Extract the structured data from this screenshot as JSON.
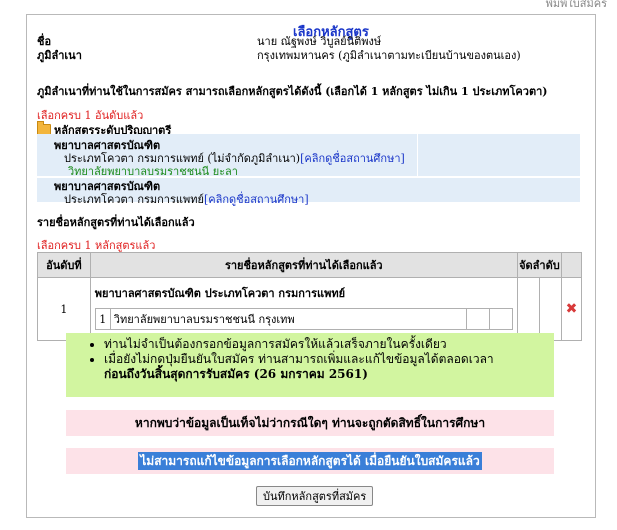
{
  "top_right_fragment": "พิมพ์ใบสมัคร",
  "legend": "เลือกหลักสูตร",
  "applicant": {
    "name_label": "ชื่อ",
    "name_value": "นาย ณัฐพงษ์ วิบูลย์นิติพงษ์",
    "domicile_label": "ภูมิลำเนา",
    "domicile_value": "กรุงเทพมหานคร (ภูมิลำเนาตามทะเบียนบ้านของตนเอง)"
  },
  "instruction": "ภูมิลำเนาที่ท่านใช้ในการสมัคร สามารถเลือกหลักสูตรได้ดังนี้ (เลือกได้ 1 หลักสูตร ไม่เกิน 1 ประเภทโควตา)",
  "rank_full": "เลือกครบ 1 อันดับแล้ว",
  "level_heading": "หลักสูตรระดับปริญญาตรี",
  "programs": [
    {
      "title": "พยาบาลศาสตรบัณฑิต",
      "quota": "ประเภทโควตา กรมการแพทย์ (ไม่จำกัดภูมิลำเนา)",
      "link": "[คลิกดูชื่อสถานศึกษา]",
      "college": "วิทยาลัยพยาบาลบรมราชชนนี ยะลา"
    },
    {
      "title": "พยาบาลศาสตรบัณฑิต",
      "quota": "ประเภทโควตา กรมการแพทย์",
      "link": "[คลิกดูชื่อสถานศึกษา]"
    }
  ],
  "selected_heading": "รายชื่อหลักสูตรที่ท่านได้เลือกแล้ว",
  "selected_full": "เลือกครบ 1 หลักสูตรแล้ว",
  "table": {
    "headers": [
      "อันดับที่",
      "รายชื่อหลักสูตรที่ท่านได้เลือกแล้ว",
      "จัดลำดับ"
    ],
    "row": {
      "rank": "1",
      "program": "พยาบาลศาสตรบัณฑิต ประเภทโควตา กรมการแพทย์",
      "sub_rank": "1",
      "sub_college": "วิทยาลัยพยาบาลบรมราชชนนี กรุงเทพ"
    }
  },
  "notices": [
    "ท่านไม่จำเป็นต้องกรอกข้อมูลการสมัครให้แล้วเสร็จภายในครั้งเดียว",
    "เมื่อยังไม่กดปุ่มยืนยันใบสมัคร ท่านสามารถเพิ่มและแก้ไขข้อมูลได้ตลอดเวลา",
    "ก่อนถึงวันสิ้นสุดการรับสมัคร (26 มกราคม 2561)"
  ],
  "warning": "หากพบว่าข้อมูลเป็นเท็จไม่ว่ากรณีใดๆ ท่านจะถูกตัดสิทธิ์ในการศึกษา",
  "locked_note": "ไม่สามารถแก้ไขข้อมูลการเลือกหลักสูตรได้ เมื่อยืนยันใบสมัครแล้ว",
  "save_button": "บันทึกหลักสูตรที่สมัคร",
  "colors": {
    "blue": "#1a36c9",
    "red": "#e02020",
    "green": "#1a8a1a",
    "notice_bg": "#d2f5a0",
    "warn_bg": "#fde2e8",
    "row_bg": "#e2edf8"
  }
}
